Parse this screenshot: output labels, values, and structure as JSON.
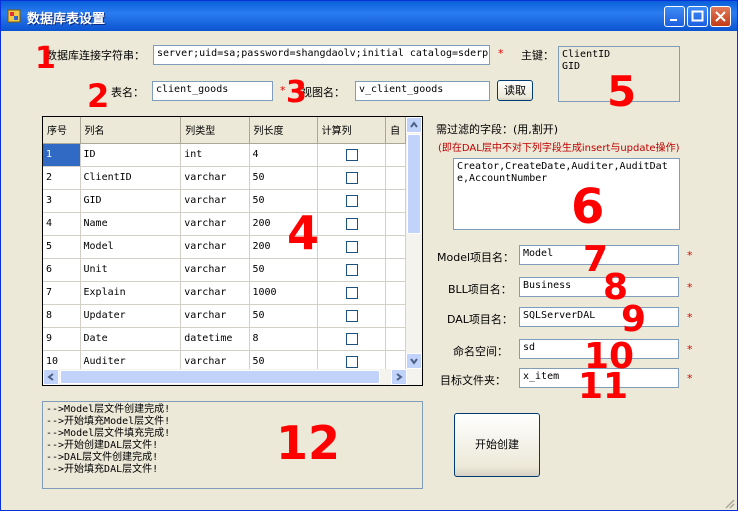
{
  "window": {
    "title": "数据库表设置"
  },
  "connection": {
    "label": "数据库连接字符串：",
    "value": "server;uid=sa;password=shangdaolv;initial catalog=sderp",
    "required": "*"
  },
  "primary_key": {
    "label": "主键：",
    "values": [
      "ClientID",
      "GID"
    ]
  },
  "table": {
    "label": "表名：",
    "value": "client_goods",
    "required": "*"
  },
  "view": {
    "label": "视图名：",
    "value": "v_client_goods"
  },
  "read_button": "读取",
  "grid": {
    "headers": [
      "序号",
      "列名",
      "列类型",
      "列长度",
      "计算列",
      "自"
    ],
    "rows": [
      [
        "1",
        "ID",
        "int",
        "4"
      ],
      [
        "2",
        "ClientID",
        "varchar",
        "50"
      ],
      [
        "3",
        "GID",
        "varchar",
        "50"
      ],
      [
        "4",
        "Name",
        "varchar",
        "200"
      ],
      [
        "5",
        "Model",
        "varchar",
        "200"
      ],
      [
        "6",
        "Unit",
        "varchar",
        "50"
      ],
      [
        "7",
        "Explain",
        "varchar",
        "1000"
      ],
      [
        "8",
        "Updater",
        "varchar",
        "50"
      ],
      [
        "9",
        "Date",
        "datetime",
        "8"
      ],
      [
        "10",
        "Auditer",
        "varchar",
        "50"
      ]
    ]
  },
  "filter": {
    "label": "需过滤的字段：(用,割开)",
    "note": "(即在DAL层中不对下列字段生成insert与update操作)",
    "value": "Creator,CreateDate,Auditer,AuditDate,AccountNumber"
  },
  "model_project": {
    "label": "Model项目名：",
    "value": "Model",
    "required": "*"
  },
  "bll_project": {
    "label": "BLL项目名：",
    "value": "Business",
    "required": "*"
  },
  "dal_project": {
    "label": "DAL项目名：",
    "value": "SQLServerDAL",
    "required": "*"
  },
  "namespace": {
    "label": "命名空间：",
    "value": "sd",
    "required": "*"
  },
  "target_folder": {
    "label": "目标文件夹：",
    "value": "x_item",
    "required": "*"
  },
  "create_button": "开始创建",
  "log": [
    "-->Model层文件创建完成!",
    "-->开始填充Model层文件!",
    "-->Model层文件填充完成!",
    "-->开始创建DAL层文件!",
    "-->DAL层文件创建完成!",
    "-->开始填充DAL层文件!"
  ],
  "annotations": [
    "1",
    "2",
    "3",
    "4",
    "5",
    "6",
    "7",
    "8",
    "9",
    "10",
    "11",
    "12"
  ]
}
